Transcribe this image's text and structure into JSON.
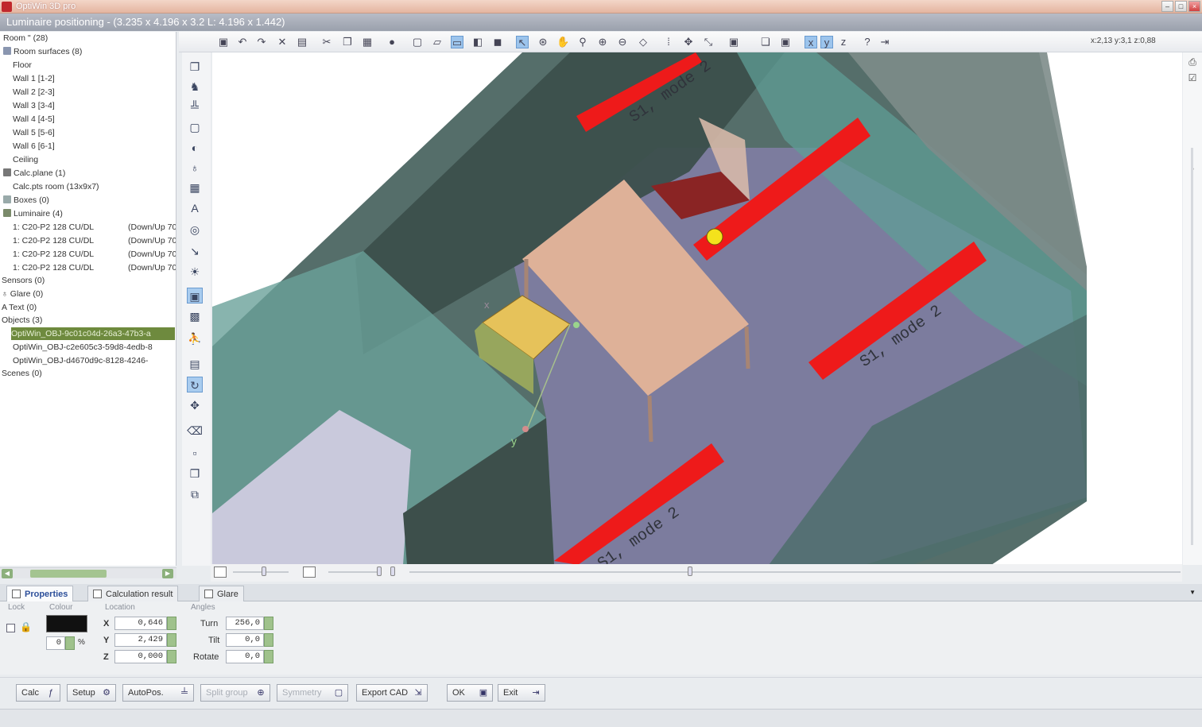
{
  "window": {
    "app_title": "OptiWin 3D pro",
    "subtitle": "Luminaire positioning - (3.235 x 4.196 x 3.2 L: 4.196 x 1.442)"
  },
  "tree": {
    "items": [
      {
        "label": "Room \" (28)"
      },
      {
        "label": "Room surfaces (8)"
      },
      {
        "label": "Floor"
      },
      {
        "label": "Wall 1 [1-2]"
      },
      {
        "label": "Wall 2 [2-3]"
      },
      {
        "label": "Wall 3 [3-4]"
      },
      {
        "label": "Wall 4 [4-5]"
      },
      {
        "label": "Wall 5 [5-6]"
      },
      {
        "label": "Wall 6 [6-1]"
      },
      {
        "label": "Ceiling"
      },
      {
        "label": "Calc.plane (1)"
      },
      {
        "label": "Calc.pts room (13x9x7)"
      },
      {
        "label": "Boxes (0)"
      },
      {
        "label": "Luminaire (4)"
      },
      {
        "label": "1: C20-P2 128 CU/DL",
        "extra": "(Down/Up 70"
      },
      {
        "label": "1: C20-P2 128 CU/DL",
        "extra": "(Down/Up 70"
      },
      {
        "label": "1: C20-P2 128 CU/DL",
        "extra": "(Down/Up 70"
      },
      {
        "label": "1: C20-P2 128 CU/DL",
        "extra": "(Down/Up 70"
      },
      {
        "label": "Sensors (0)"
      },
      {
        "label": "Glare (0)"
      },
      {
        "label": "Text (0)"
      },
      {
        "label": "Objects (3)"
      },
      {
        "label": "OptiWin_OBJ-9c01c04d-26a3-47b3-a"
      },
      {
        "label": "OptiWin_OBJ-c2e605c3-59d8-4edb-8"
      },
      {
        "label": "OptiWin_OBJ-d4670d9c-8128-4246-"
      },
      {
        "label": "Scenes (0)"
      }
    ]
  },
  "toolbar": {
    "coords": "x:2,13 y:3,1 z:0,88"
  },
  "viewport": {
    "luminaire_label": "S1, mode 2",
    "axis_x": "x",
    "axis_y": "y",
    "colors": {
      "luminaire": "#ee1a1a",
      "floor": "#7c7c9e",
      "wall_dark": "#3c4f4c",
      "wall_glass": "#5f9e96",
      "table": "#deb198",
      "chair_red": "#8a2424",
      "chair_selected": "#e6c25a"
    }
  },
  "tabs": [
    {
      "label": "Properties"
    },
    {
      "label": "Calculation result"
    },
    {
      "label": "Glare"
    }
  ],
  "properties": {
    "groups": {
      "lock": "Lock",
      "colour": "Colour",
      "location": "Location",
      "angles": "Angles"
    },
    "color_value": "0",
    "color_unit": "%",
    "location": [
      {
        "axis": "X",
        "value": "0,646"
      },
      {
        "axis": "Y",
        "value": "2,429"
      },
      {
        "axis": "Z",
        "value": "0,000"
      }
    ],
    "angles": [
      {
        "name": "Turn",
        "value": "256,0"
      },
      {
        "name": "Tilt",
        "value": "0,0"
      },
      {
        "name": "Rotate",
        "value": "0,0"
      }
    ]
  },
  "buttons": [
    {
      "label": "Calc",
      "icon": "fx-icon"
    },
    {
      "label": "Setup",
      "icon": "gear-icon"
    },
    {
      "label": "AutoPos.",
      "icon": "autopos-icon"
    },
    {
      "label": "Split group",
      "icon": "split-icon"
    },
    {
      "label": "Symmetry",
      "icon": "symmetry-icon"
    },
    {
      "label": "Export CAD",
      "icon": "export-icon"
    },
    {
      "label": "OK",
      "icon": "save-icon"
    },
    {
      "label": "Exit",
      "icon": "exit-icon"
    }
  ]
}
